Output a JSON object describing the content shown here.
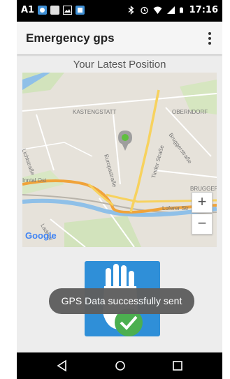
{
  "status_bar": {
    "carrier": "A1",
    "time": "17:16",
    "icons": [
      "notification-icon",
      "notification-icon",
      "image-icon",
      "notification-icon",
      "bluetooth-icon",
      "alarm-icon",
      "wifi-icon",
      "signal-icon",
      "battery-icon"
    ]
  },
  "app_bar": {
    "title": "Emergency gps",
    "menu_icon": "overflow-menu-icon"
  },
  "map_section": {
    "title": "Your Latest Position",
    "labels": {
      "kastengstatt": "KASTENGSTATT",
      "oberndorf": "OBERNDORF",
      "lichtstrasse": "Lichtstraße",
      "europastrasse": "Europastraße",
      "tinder": "Tinder Straße",
      "brugger": "Bruggerstraße",
      "bruggern": "BRUGGERN",
      "loferer": "Loferer Str",
      "ladestr": "Ladestr",
      "river": "Inntal Ost"
    },
    "zoom_in": "+",
    "zoom_out": "−",
    "attribution": "Google",
    "colors": {
      "land": "#e6e2da",
      "water": "#8fc0e8",
      "highway": "#f0a33a",
      "road": "#f7d25e",
      "green": "#c9e0b0"
    }
  },
  "sos_button": {
    "icon": "hand-stop-icon",
    "badge_icon": "checkmark-icon",
    "color": "#2f8fd8"
  },
  "toast": {
    "message": "GPS Data successfully sent"
  },
  "nav_bar": {
    "back_icon": "back-triangle-icon",
    "home_icon": "home-circle-icon",
    "recents_icon": "recents-square-icon"
  }
}
